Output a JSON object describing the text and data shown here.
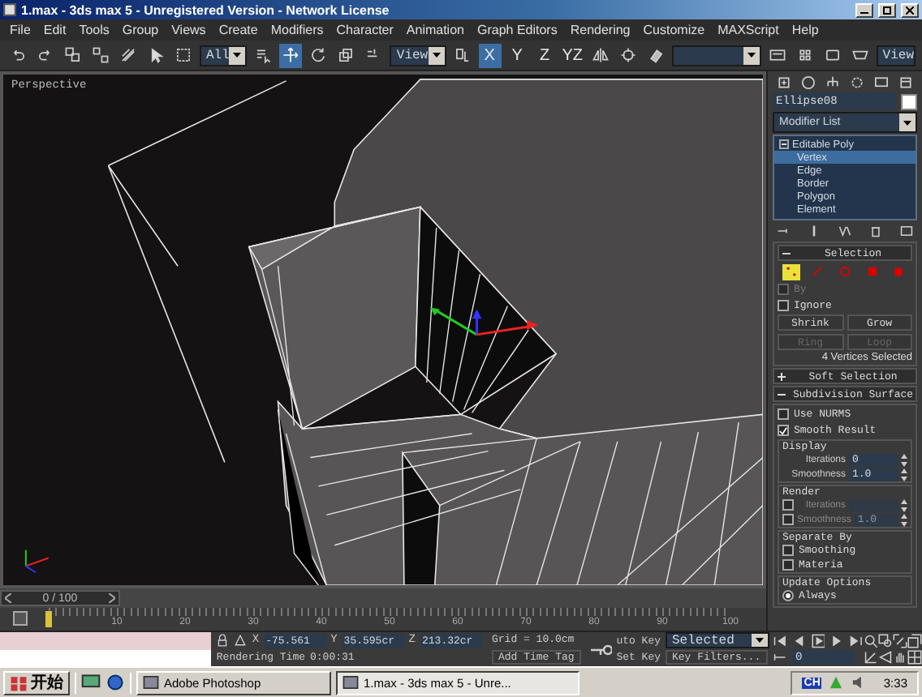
{
  "window": {
    "title": "1.max - 3ds max 5 - Unregistered Version - Network License"
  },
  "menu": [
    "File",
    "Edit",
    "Tools",
    "Group",
    "Views",
    "Create",
    "Modifiers",
    "Character",
    "Animation",
    "Graph Editors",
    "Rendering",
    "Customize",
    "MAXScript",
    "Help"
  ],
  "toolbar": {
    "selection_filter": "All",
    "transform_tools": [
      {
        "kind": "move",
        "selected": true
      },
      {
        "kind": "rotate",
        "selected": false
      },
      {
        "kind": "scale",
        "selected": false
      }
    ],
    "reference_coord": "View",
    "axes": [
      {
        "label": "X",
        "selected": true
      },
      {
        "label": "Y",
        "selected": false
      },
      {
        "label": "Z",
        "selected": false
      },
      {
        "label": "YZ",
        "selected": false
      }
    ],
    "render_type": "View"
  },
  "viewport": {
    "label": "Perspective"
  },
  "time_slider": {
    "label": "0 / 100",
    "level": 0
  },
  "track_bar": {
    "ticks": [
      "10",
      "20",
      "30",
      "40",
      "50",
      "60",
      "70",
      "80",
      "90",
      "100"
    ]
  },
  "command_panel": {
    "object_name": "Ellipse08",
    "modifier_list": "Modifier List",
    "stack": [
      {
        "label": "Editable Poly",
        "expanded": true,
        "children": [
          {
            "label": "Vertex",
            "selected": true
          },
          {
            "label": "Edge",
            "selected": false
          },
          {
            "label": "Border",
            "selected": false
          },
          {
            "label": "Polygon",
            "selected": false
          },
          {
            "label": "Element",
            "selected": false
          }
        ]
      }
    ],
    "selection": {
      "title": "Selection",
      "levels": [
        {
          "kind": "vertex",
          "selected": true
        },
        {
          "kind": "edge",
          "selected": false
        },
        {
          "kind": "border",
          "selected": false
        },
        {
          "kind": "polygon",
          "selected": false
        },
        {
          "kind": "element",
          "selected": false
        }
      ],
      "by": {
        "label": "By",
        "checked": false,
        "disabled": true
      },
      "ignore": {
        "label": "Ignore",
        "checked": false,
        "disabled": false
      },
      "buttons": [
        {
          "label": "Shrink",
          "disabled": false
        },
        {
          "label": "Grow",
          "disabled": false
        },
        {
          "label": "Ring",
          "disabled": true
        },
        {
          "label": "Loop",
          "disabled": true
        }
      ],
      "status": "4 Vertices Selected"
    },
    "rollouts": [
      {
        "title": "Soft Selection",
        "expanded": false
      },
      {
        "title": "Subdivision Surface",
        "expanded": true
      }
    ],
    "subdivision": {
      "use_nurms": {
        "label": "Use NURMS",
        "checked": false
      },
      "smooth_result": {
        "label": "Smooth Result",
        "checked": true
      },
      "display": {
        "title": "Display",
        "iterations": {
          "label": "Iterations",
          "value": "0"
        },
        "smoothness": {
          "label": "Smoothness",
          "value": "1.0"
        }
      },
      "render": {
        "title": "Render",
        "iterations": {
          "label": "Iterations",
          "checked": false
        },
        "smoothness": {
          "label": "Smoothness",
          "checked": false,
          "value": "1.0"
        }
      },
      "separate_by": {
        "title": "Separate By",
        "options": [
          {
            "label": "Smoothing",
            "checked": false
          },
          {
            "label": "Materia",
            "checked": false
          }
        ]
      },
      "update_options": {
        "title": "Update Options",
        "options": [
          {
            "label": "Always",
            "selected": true
          }
        ]
      }
    }
  },
  "status": {
    "coords": [
      {
        "axis": "X",
        "value": "-75.561"
      },
      {
        "axis": "Y",
        "value": "35.595cr"
      },
      {
        "axis": "Z",
        "value": "213.32cr"
      }
    ],
    "grid": "Grid = 10.0cm",
    "rendering_label": "Rendering Time",
    "rendering_time": "0:00:31",
    "add_time_tag": "Add Time Tag",
    "auto_key": "uto Key",
    "key_mode": "Selected",
    "set_key": "Set Key",
    "key_filters": "Key Filters...",
    "current_frame": "0"
  },
  "taskbar": {
    "start": "开始",
    "tasks": [
      {
        "label": "Adobe Photoshop",
        "selected": false
      },
      {
        "label": "1.max - 3ds max 5 - Unre...",
        "selected": true
      }
    ],
    "language": "CH",
    "clock": "3:33"
  }
}
